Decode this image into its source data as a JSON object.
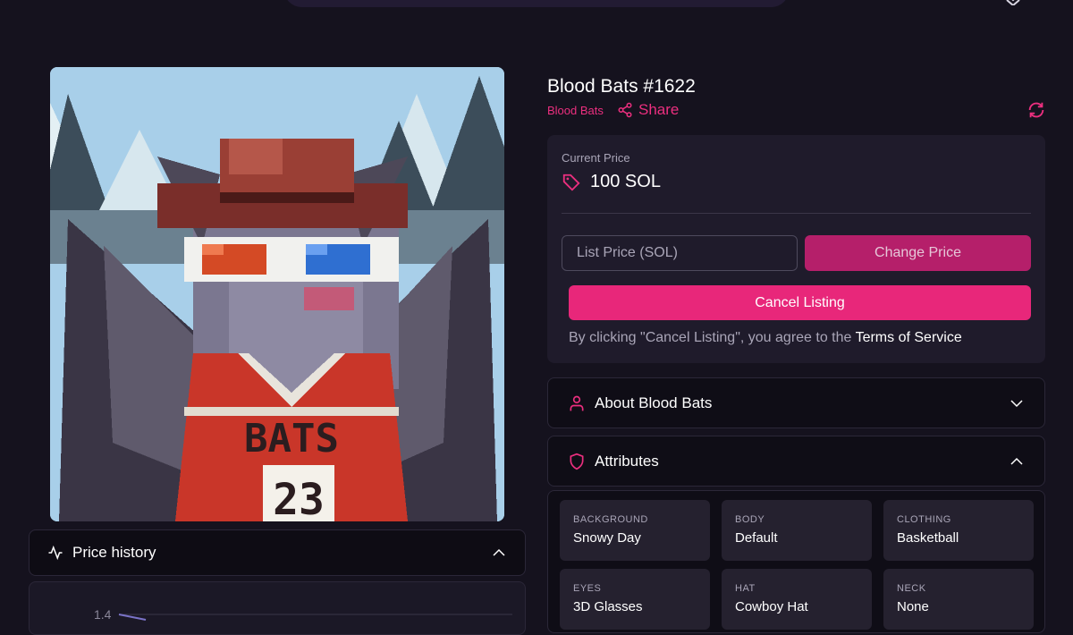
{
  "nft": {
    "title": "Blood Bats #1622",
    "collection": "Blood Bats",
    "share_label": "Share"
  },
  "price": {
    "label": "Current Price",
    "value": "100 SOL",
    "list_placeholder": "List Price (SOL)",
    "change_label": "Change Price",
    "cancel_label": "Cancel Listing",
    "agree_text": "By clicking \"Cancel Listing\", you agree to the",
    "tos_label": "Terms of Service"
  },
  "sections": {
    "about": "About Blood Bats",
    "attributes": "Attributes",
    "price_history": "Price history"
  },
  "chart_data": {
    "type": "line",
    "tick_labels": [
      "1.4"
    ]
  },
  "attributes": [
    {
      "trait": "BACKGROUND",
      "value": "Snowy Day"
    },
    {
      "trait": "BODY",
      "value": "Default"
    },
    {
      "trait": "CLOTHING",
      "value": "Basketball"
    },
    {
      "trait": "EYES",
      "value": "3D Glasses"
    },
    {
      "trait": "HAT",
      "value": "Cowboy Hat"
    },
    {
      "trait": "NECK",
      "value": "None"
    }
  ],
  "colors": {
    "accent": "#ec2f7f",
    "background": "#15121e",
    "card": "#1f1b2b"
  }
}
